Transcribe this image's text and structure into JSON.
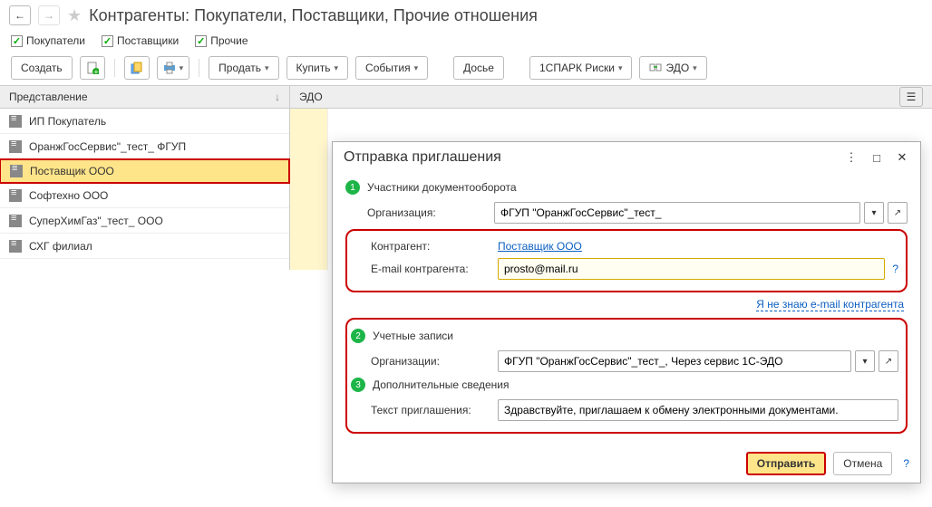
{
  "header": {
    "title": "Контрагенты: Покупатели, Поставщики, Прочие отношения"
  },
  "checkboxes": {
    "buyers": "Покупатели",
    "suppliers": "Поставщики",
    "other": "Прочие"
  },
  "toolbar": {
    "create": "Создать",
    "sell": "Продать",
    "buy": "Купить",
    "events": "События",
    "dossier": "Досье",
    "spark": "1СПАРК Риски",
    "edo": "ЭДО"
  },
  "columns": {
    "representation": "Представление",
    "edo": "ЭДО"
  },
  "rows": [
    {
      "label": "ИП Покупатель",
      "selected": false
    },
    {
      "label": "ОранжГосСервис\"_тест_ ФГУП",
      "selected": false
    },
    {
      "label": "Поставщик ООО",
      "selected": true
    },
    {
      "label": "Софтехно ООО",
      "selected": false
    },
    {
      "label": "СуперХимГаз\"_тест_ ООО",
      "selected": false
    },
    {
      "label": "СХГ филиал",
      "selected": false
    }
  ],
  "dialog": {
    "title": "Отправка приглашения",
    "step1": "Участники документооборота",
    "org_label": "Организация:",
    "org_value": "ФГУП \"ОранжГосСервис\"_тест_",
    "contractor_label": "Контрагент:",
    "contractor_value": "Поставщик ООО",
    "email_label": "E-mail контрагента:",
    "email_value": "prosto@mail.ru",
    "unknown_email": "Я не знаю e-mail контрагента",
    "step2": "Учетные записи",
    "accounts_label": "Организации:",
    "accounts_value": "ФГУП \"ОранжГосСервис\"_тест_, Через сервис 1С-ЭДО",
    "step3": "Дополнительные сведения",
    "invite_text_label": "Текст приглашения:",
    "invite_text_value": "Здравствуйте, приглашаем к обмену электронными документами.",
    "send": "Отправить",
    "cancel": "Отмена",
    "help": "?"
  }
}
